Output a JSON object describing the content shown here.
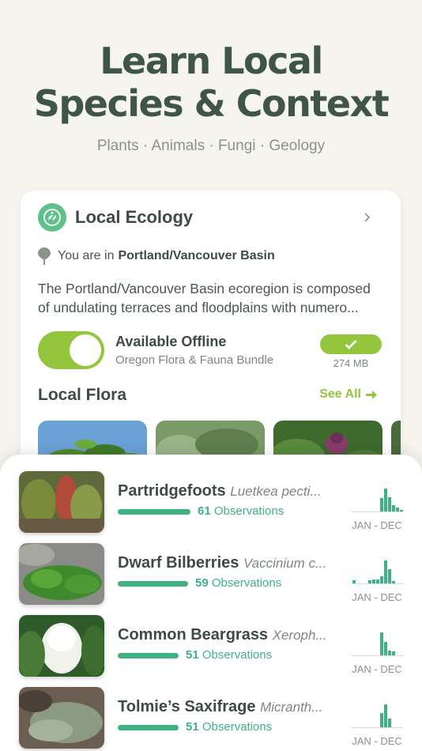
{
  "hero": {
    "title_line1": "Learn Local",
    "title_line2": "Species & Context",
    "subtitle": "Plants · Animals · Fungi · Geology"
  },
  "card": {
    "title": "Local Ecology",
    "location_prefix": "You are in",
    "location_name": "Portland/Vancouver Basin",
    "description": "The Portland/Vancouver Basin ecoregion is composed of undulating terraces and floodplains with numero...",
    "offline_title": "Available Offline",
    "offline_bundle": "Oregon Flora & Fauna Bundle",
    "download_size": "274 MB",
    "offline_enabled": true,
    "flora_title": "Local Flora",
    "see_all": "See All"
  },
  "species": [
    {
      "name": "Partridgefoots",
      "sci": "Luetkea pecti...",
      "count": "61",
      "obs_label": "Observations",
      "obs_fraction": 0.61,
      "range": "JAN - DEC",
      "hist": [
        0,
        0,
        0,
        0,
        0,
        0,
        0,
        0.55,
        0.95,
        0.6,
        0.25,
        0.15,
        0.08
      ]
    },
    {
      "name": "Dwarf Bilberries",
      "sci": "Vaccinium c...",
      "count": "59",
      "obs_label": "Observations",
      "obs_fraction": 0.59,
      "range": "JAN - DEC",
      "hist": [
        0.12,
        0,
        0,
        0,
        0.12,
        0.18,
        0.15,
        0.3,
        0.95,
        0.6,
        0.1,
        0,
        0
      ]
    },
    {
      "name": "Common Beargrass",
      "sci": "Xeroph...",
      "count": "51",
      "obs_label": "Observations",
      "obs_fraction": 0.51,
      "range": "JAN - DEC",
      "hist": [
        0,
        0,
        0,
        0,
        0,
        0,
        0,
        0.95,
        0.55,
        0.2,
        0.18,
        0,
        0
      ]
    },
    {
      "name": "Tolmie’s Saxifrage",
      "sci": "Micranth...",
      "count": "51",
      "obs_label": "Observations",
      "obs_fraction": 0.51,
      "range": "JAN - DEC",
      "hist": [
        0,
        0,
        0,
        0,
        0,
        0,
        0,
        0.6,
        0.95,
        0.35,
        0,
        0,
        0
      ]
    }
  ],
  "colors": {
    "accent_green": "#94c63d",
    "obs_green": "#3fb182",
    "title_green": "#3e5548"
  }
}
